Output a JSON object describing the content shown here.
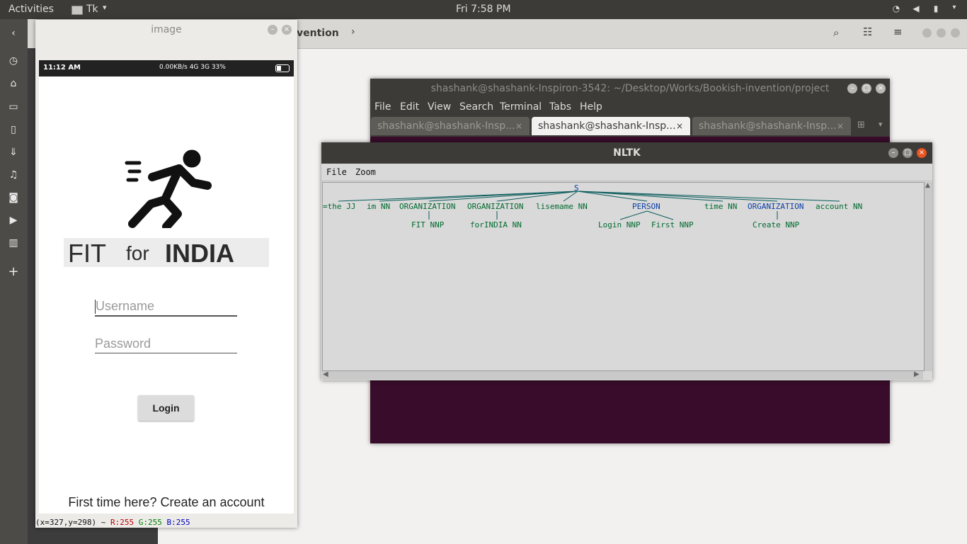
{
  "topbar": {
    "activities": "Activities",
    "app_name": "Tk",
    "clock": "Fri  7:58 PM"
  },
  "files": {
    "path_tail": "vention"
  },
  "image_window": {
    "title": "image",
    "phone": {
      "time": "11:12 AM",
      "status_right": "0.00KB/s  4G  3G 33%",
      "logo_text_fit": "FIT",
      "logo_text_for": "for",
      "logo_text_india": "INDIA",
      "username_placeholder": "Username",
      "password_placeholder": "Password",
      "login_label": "Login",
      "signup_text": "First time here? Create an account"
    },
    "readout_xy": "(x=327,y=298) ~",
    "readout_r": "R:255",
    "readout_g": "G:255",
    "readout_b": "B:255"
  },
  "terminal": {
    "title": "shashank@shashank-Inspiron-3542: ~/Desktop/Works/Bookish-invention/project",
    "menu": [
      "File",
      "Edit",
      "View",
      "Search",
      "Terminal",
      "Tabs",
      "Help"
    ],
    "tabs": [
      "shashank@shashank-Insp...",
      "shashank@shashank-Insp...",
      "shashank@shashank-Insp..."
    ]
  },
  "nltk": {
    "title": "NLTK",
    "menu": [
      "File",
      "Zoom"
    ],
    "root": "S",
    "nodes": [
      {
        "text": "=the JJ",
        "kind": "token"
      },
      {
        "text": "im NN",
        "kind": "token"
      },
      {
        "text": "ORGANIZATION",
        "kind": "label",
        "child": "FIT NNP"
      },
      {
        "text": "ORGANIZATION",
        "kind": "label",
        "child": "forINDIA NN"
      },
      {
        "text": "lisemame NN",
        "kind": "token"
      },
      {
        "text": "PERSON",
        "kind": "label",
        "children": [
          "Login NNP",
          "First NNP"
        ]
      },
      {
        "text": "time NN",
        "kind": "token"
      },
      {
        "text": "ORGANIZATION",
        "kind": "label",
        "child": "Create NNP"
      },
      {
        "text": "account NN",
        "kind": "token"
      }
    ]
  },
  "colors": {
    "terminal_bg": "#380c2a",
    "tree_token": "#006a2f",
    "tree_label": "#0a3ea8"
  }
}
